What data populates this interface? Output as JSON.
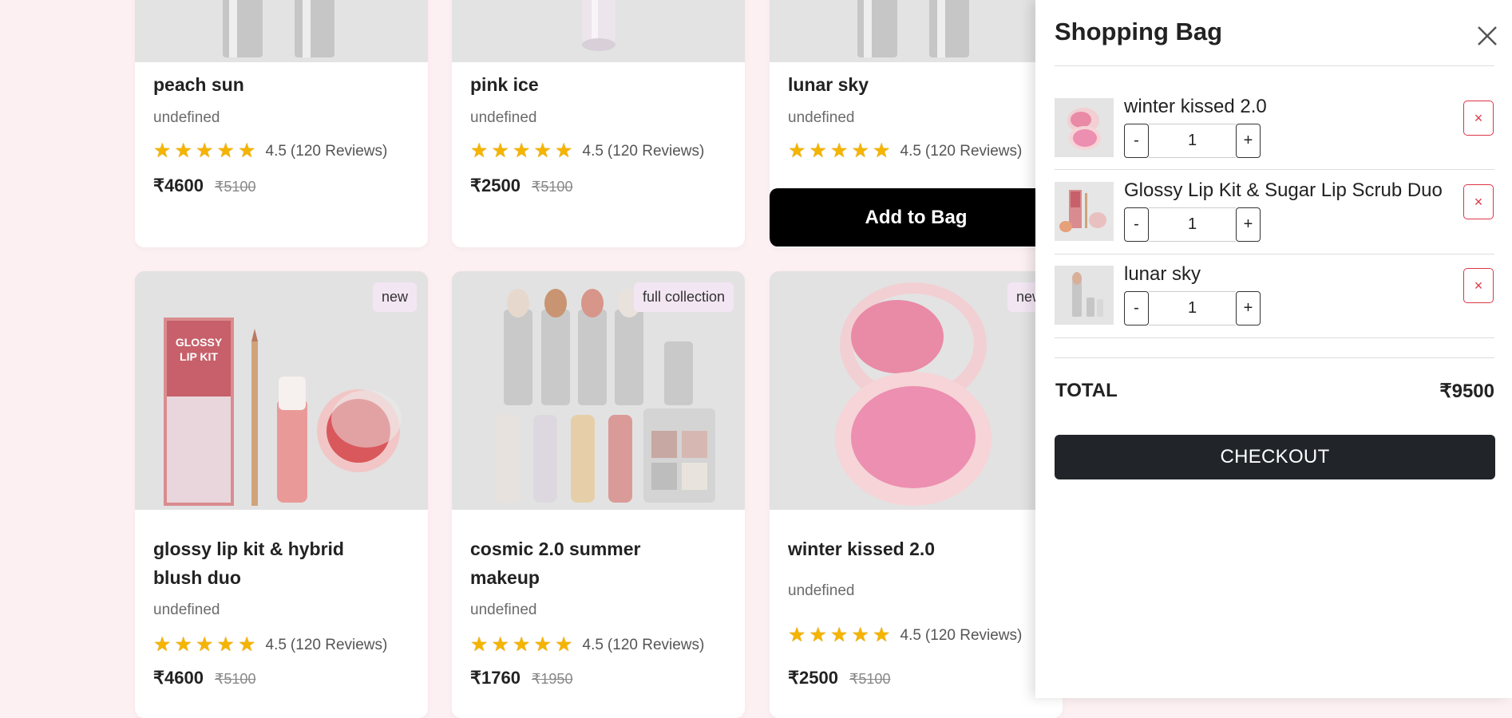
{
  "products": [
    {
      "name": "peach sun",
      "subtitle": "undefined",
      "rating": "4.5",
      "reviews": "(120 Reviews)",
      "price": "₹4600",
      "old_price": "₹5100"
    },
    {
      "name": "pink ice",
      "subtitle": "undefined",
      "rating": "4.5",
      "reviews": "(120 Reviews)",
      "price": "₹2500",
      "old_price": "₹5100"
    },
    {
      "name": "lunar sky",
      "subtitle": "undefined",
      "rating": "4.5",
      "reviews": "(120 Reviews)",
      "action": "Add to Bag"
    },
    {
      "name": "glossy lip kit & hybrid blush duo",
      "subtitle": "undefined",
      "rating": "4.5",
      "reviews": "(120 Reviews)",
      "price": "₹4600",
      "old_price": "₹5100",
      "badge": "new"
    },
    {
      "name": "cosmic 2.0 summer makeup",
      "subtitle": "undefined",
      "rating": "4.5",
      "reviews": "(120 Reviews)",
      "price": "₹1760",
      "old_price": "₹1950",
      "badge": "full collection"
    },
    {
      "name": "winter kissed 2.0",
      "subtitle": "undefined",
      "rating": "4.5",
      "reviews": "(120 Reviews)",
      "price": "₹2500",
      "old_price": "₹5100",
      "badge": "new"
    }
  ],
  "bag": {
    "title": "Shopping Bag",
    "items": [
      {
        "name": "winter kissed 2.0",
        "qty": "1"
      },
      {
        "name": "Glossy Lip Kit & Sugar Lip Scrub Duo",
        "qty": "1"
      },
      {
        "name": "lunar sky",
        "qty": "1"
      }
    ],
    "minus": "-",
    "plus": "+",
    "remove": "×",
    "total_label": "TOTAL",
    "total_value": "₹9500",
    "checkout": "CHECKOUT"
  },
  "icons": {
    "star": "★",
    "close": "close-icon"
  }
}
